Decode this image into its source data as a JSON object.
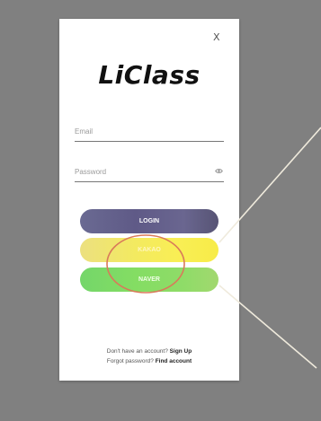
{
  "close": {
    "symbol": "X"
  },
  "logo": {
    "text": "LiClass"
  },
  "email": {
    "placeholder": "Email"
  },
  "password": {
    "placeholder": "Password"
  },
  "buttons": {
    "login": "LOGIN",
    "kakao": "KAKAO",
    "naver": "NAVER"
  },
  "footer": {
    "signup_prompt": "Don't have an account?",
    "signup_link": "Sign Up",
    "forgot_prompt": "Forgot password?",
    "find_link": "Find account"
  },
  "colors": {
    "background": "#808080",
    "card": "#ffffff",
    "login_button": "#625e88",
    "kakao_button": "#f5ea55",
    "naver_button": "#84dc66",
    "highlight_circle": "#d97a5a",
    "pointer_lines": "#efeadc"
  }
}
